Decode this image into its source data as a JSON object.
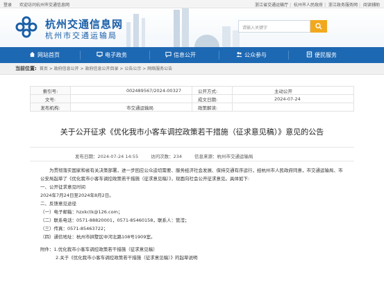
{
  "topbar": {
    "left": [
      "登录",
      "欢迎访问杭州市交通信息网"
    ],
    "right": [
      "浙江省交通运输厅",
      "杭州市人民政府",
      "浙江政务服务网",
      "阅读辅助"
    ]
  },
  "header": {
    "site_name": "杭州交通信息网",
    "site_sub": "杭州市交通运输局",
    "search_placeholder": "请输入关键字"
  },
  "nav": {
    "items": [
      {
        "label": "网站首页",
        "icon": "home-icon"
      },
      {
        "label": "电子政务",
        "icon": "monitor-icon"
      },
      {
        "label": "信息公开",
        "icon": "chat-icon"
      },
      {
        "label": "公众参与",
        "icon": "people-icon"
      },
      {
        "label": "便民服务",
        "icon": "document-icon"
      }
    ]
  },
  "breadcrumb": {
    "current_label": "当前位置:",
    "path": "首页 > 政府信息公开 > 政府信息公开目录 > 公告公示 > 网络服务公告"
  },
  "meta": {
    "index_label": "索引号:",
    "index_value": "002489567/2024-00327",
    "method_label": "公开方式:",
    "method_value": "主动公开",
    "docno_label": "文号:",
    "docno_value": "",
    "date_label": "成文日期:",
    "date_value": "2024-07-24",
    "publisher_label": "发布机构:",
    "publisher_value": "市交通运输局",
    "interp_label": "政策解读:",
    "interp_value": ""
  },
  "article": {
    "title": "关于公开征求《优化我市小客车调控政策若干措施（征求意见稿）》意见的公告",
    "published": "发布日期：2024-07-24 14:55",
    "views": "访问次数：234",
    "source": "信息来源：杭州市交通运输局",
    "intro": "为贯彻落实国家和省有关决策部署，进一步回应公众迫切需要、服务经济社会发展、保持交通有序运行，经杭州市人民政府同意，市交通运输局、市公安局起草了《优化我市小客车调控政策若干措施（征求意见稿）》，现面向社会公开征求意见。具体如下:",
    "lines": [
      "一、公开征求意见时间",
      "2024年7月24日至2024年8月2日。",
      "二、反馈意见途径",
      "（一）电子邮箱：hzxkctk@126.com；",
      "（二）联系电话：0571-88820001，0571-85460158，联系人：管滢；",
      "（三）传真：0571-85463722；",
      "（四）通信地址：杭州市拱墅区中河北路108号1909室。"
    ],
    "attachment_1": "附件：1.优化我市小客车调控政策若干措施（征求意见稿）",
    "attachment_2": "2.关于《优化我市小客车调控政策若干措施（征求意见稿）》的起草说明"
  }
}
